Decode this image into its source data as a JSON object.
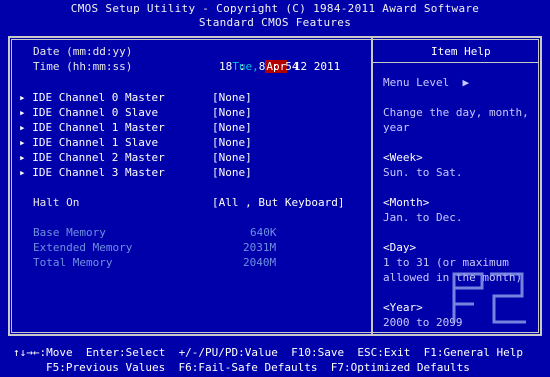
{
  "header": {
    "line1": "CMOS Setup Utility - Copyright (C) 1984-2011 Award Software",
    "line2": "Standard CMOS Features"
  },
  "date": {
    "label": "Date (mm:dd:yy)",
    "day_name": "Tue,",
    "month": "Apr",
    "rest": "12 2011"
  },
  "time": {
    "label": "Time (hh:mm:ss)",
    "value": "18 :  8 : 54"
  },
  "ide_channels": [
    {
      "label": "IDE Channel 0 Master",
      "value": "[None]"
    },
    {
      "label": "IDE Channel 0 Slave",
      "value": "[None]"
    },
    {
      "label": "IDE Channel 1 Master",
      "value": "[None]"
    },
    {
      "label": "IDE Channel 1 Slave",
      "value": "[None]"
    },
    {
      "label": "IDE Channel 2 Master",
      "value": "[None]"
    },
    {
      "label": "IDE Channel 3 Master",
      "value": "[None]"
    }
  ],
  "halt_on": {
    "label": "Halt On",
    "value": "[All , But Keyboard]"
  },
  "memory": [
    {
      "label": "Base Memory",
      "value": "640K"
    },
    {
      "label": "Extended Memory",
      "value": "2031M"
    },
    {
      "label": "Total Memory",
      "value": "2040M"
    }
  ],
  "item_help": {
    "title": "Item Help",
    "menu_level": "Menu Level  ▶",
    "description": [
      "Change the day, month,",
      "year"
    ],
    "entries": [
      {
        "key": "<Week>",
        "lines": [
          "Sun. to Sat."
        ]
      },
      {
        "key": "<Month>",
        "lines": [
          "Jan. to Dec."
        ]
      },
      {
        "key": "<Day>",
        "lines": [
          "1 to 31 (or maximum",
          "allowed in the month)"
        ]
      },
      {
        "key": "<Year>",
        "lines": [
          "2000 to 2099"
        ]
      }
    ]
  },
  "footer": {
    "line1": "↑↓→←:Move  Enter:Select  +/-/PU/PD:Value  F10:Save  ESC:Exit  F1:General Help",
    "line2": "F5:Previous Values  F6:Fail-Safe Defaults  F7:Optimized Defaults"
  },
  "watermark": {
    "text": "F"
  },
  "colors": {
    "background": "#0000aa",
    "highlight": "#b00000",
    "date_accent": "#00c8d8",
    "disabled": "#6f8fe0"
  }
}
